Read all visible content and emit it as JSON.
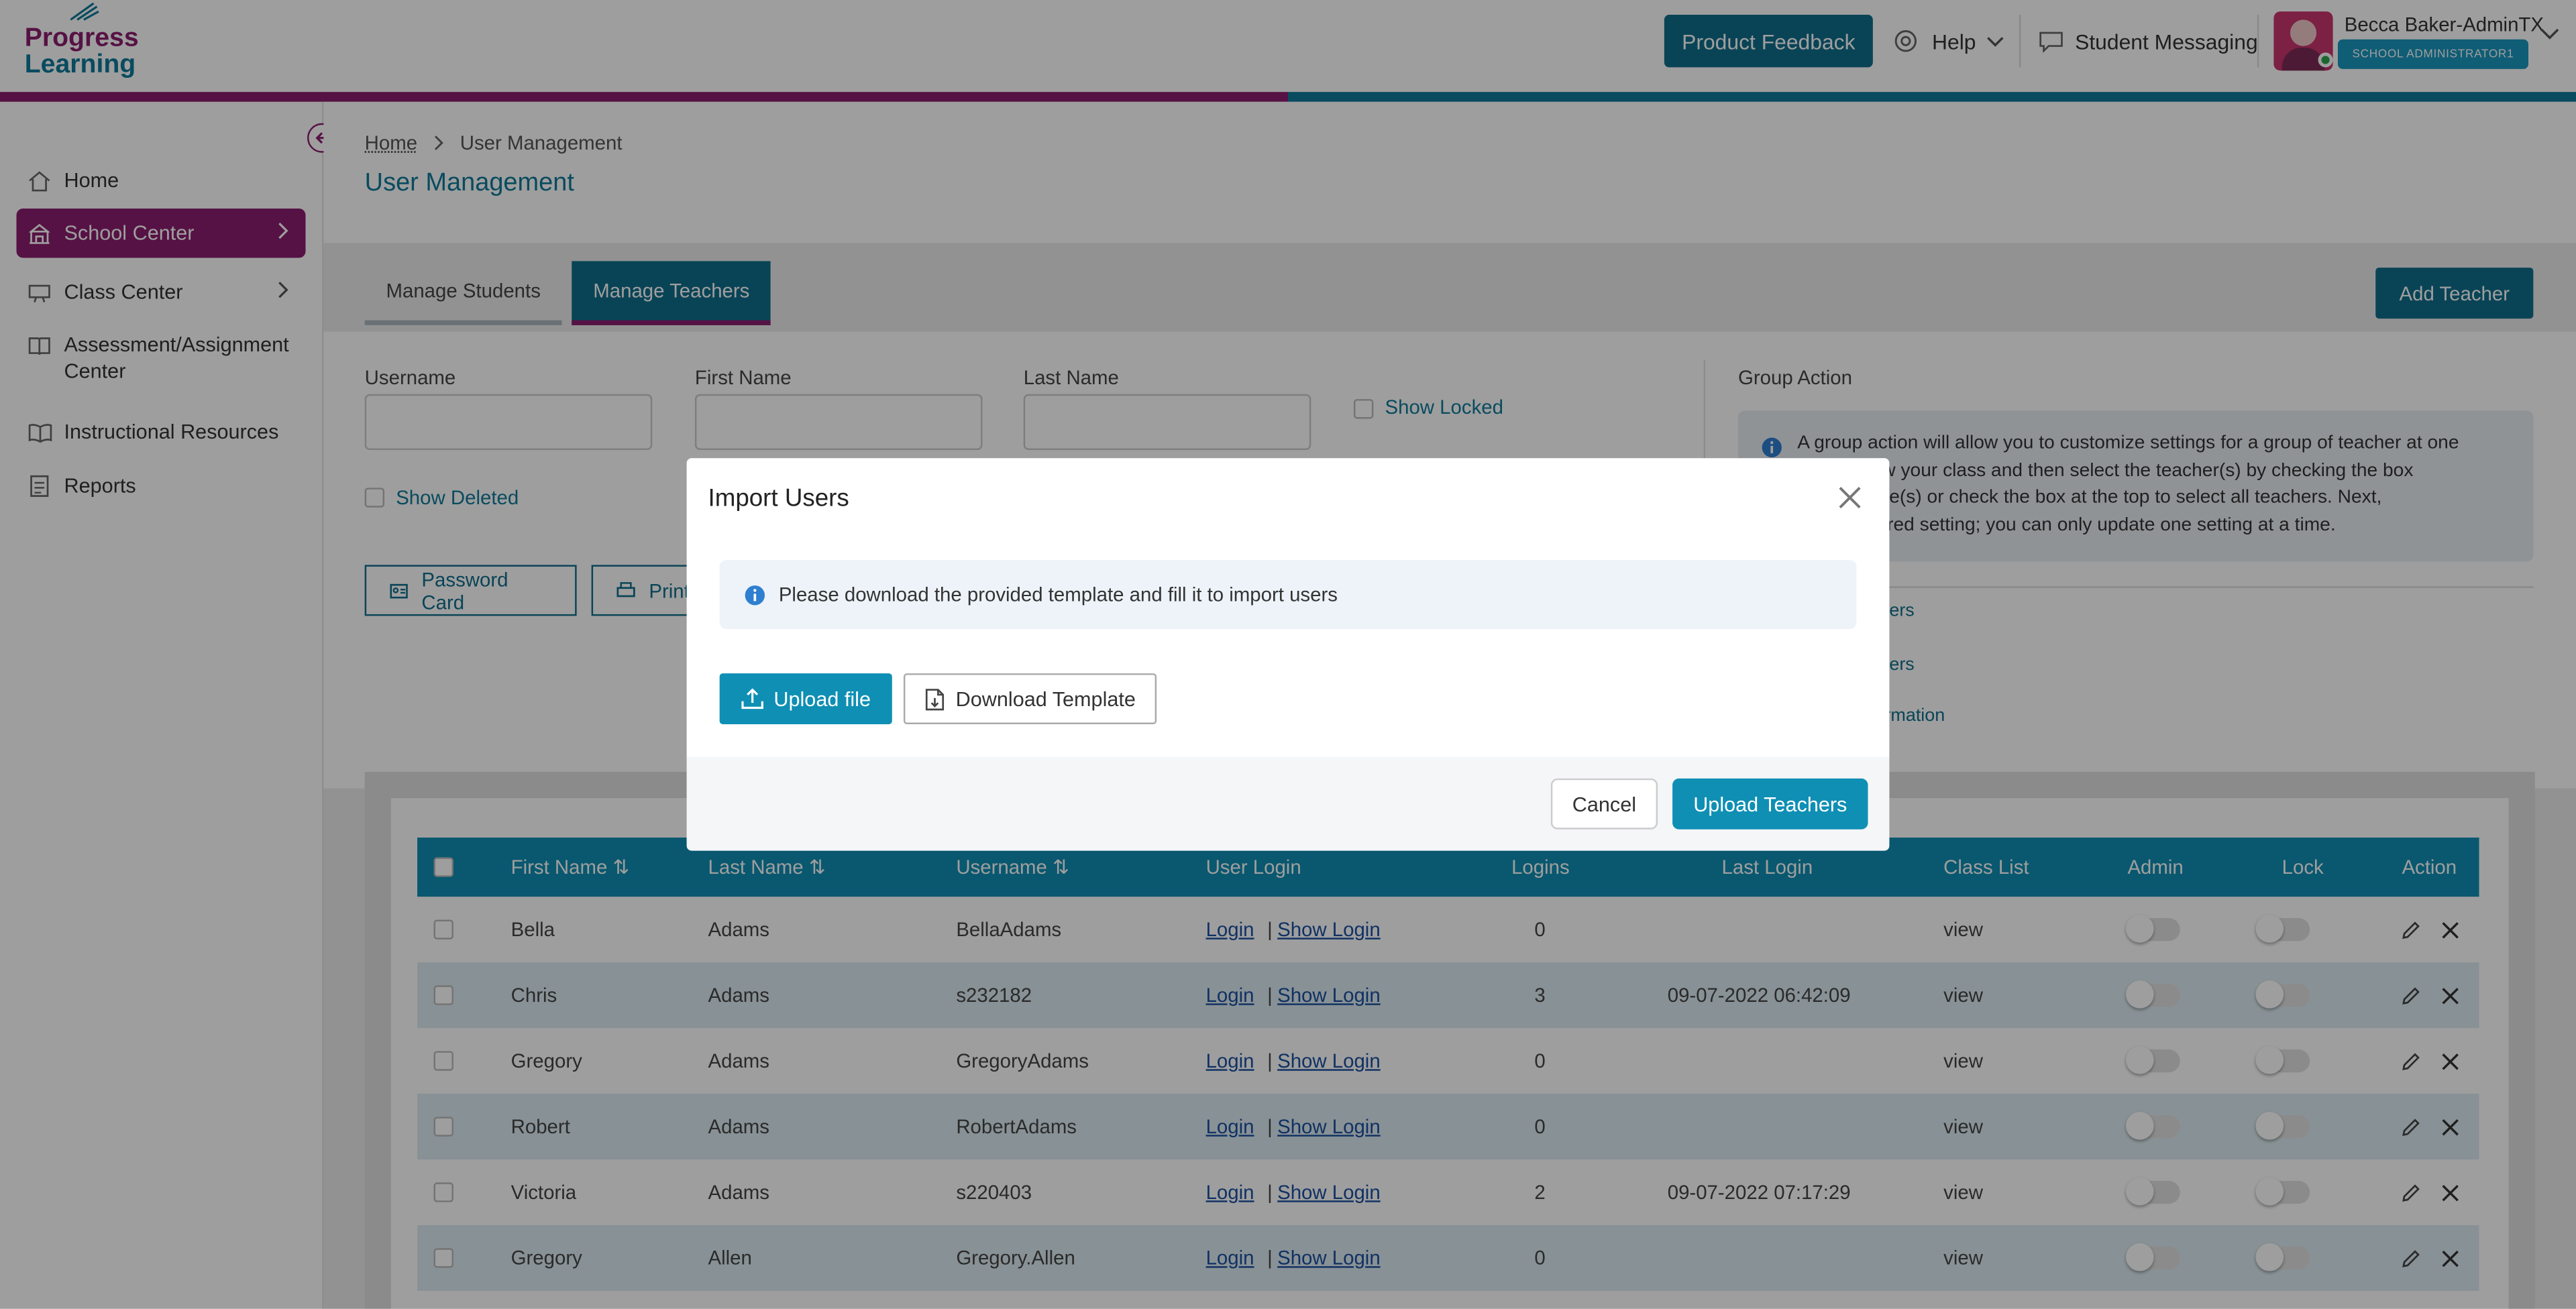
{
  "header": {
    "logo_line1": "Progress",
    "logo_line2": "Learning",
    "product_feedback": "Product Feedback",
    "help": "Help",
    "student_messaging": "Student Messaging",
    "user_name": "Becca Baker-AdminTX",
    "user_role": "SCHOOL ADMINISTRATOR1"
  },
  "colors": {
    "brand_purple": "#8c1d6e",
    "brand_teal": "#0f7a99",
    "button_teal": "#0f8fb4"
  },
  "sidebar": {
    "items": [
      {
        "label": "Home",
        "icon": "home-icon"
      },
      {
        "label": "School Center",
        "icon": "school-icon",
        "active": true
      },
      {
        "label": "Class Center",
        "icon": "class-icon"
      },
      {
        "label": "Assessment/Assignment",
        "label2": "Center",
        "icon": "book-icon"
      },
      {
        "label": "Instructional Resources",
        "icon": "book-open-icon"
      },
      {
        "label": "Reports",
        "icon": "report-icon"
      }
    ]
  },
  "breadcrumb": {
    "home": "Home",
    "current": "User Management"
  },
  "page_title": "User Management",
  "tabs": [
    {
      "label": "Manage Students"
    },
    {
      "label": "Manage Teachers",
      "active": true
    }
  ],
  "add_teacher": "Add Teacher",
  "filters": {
    "username_label": "Username",
    "first_name_label": "First Name",
    "last_name_label": "Last Name",
    "show_locked": "Show Locked",
    "show_deleted": "Show Deleted",
    "password_card": "Password Card",
    "print": "Print"
  },
  "group_action": {
    "title": "Group Action",
    "info_lines": [
      "A group action will allow you to customize settings for a group of teacher at one",
      "to view your class and then select the teacher(s) by checking the box",
      "ir name(s) or check the box at the top to select all teachers. Next,",
      "e desired setting; you can only update one setting at a time."
    ],
    "link1": "ers",
    "link2": "ers",
    "link3": "formation"
  },
  "table": {
    "columns": [
      "First Name",
      "Last Name",
      "Username",
      "User Login",
      "Logins",
      "Last Login",
      "Class List",
      "Admin",
      "Lock",
      "Action"
    ],
    "rows": [
      {
        "first": "Bella",
        "last": "Adams",
        "username": "BellaAdams",
        "login": "Login",
        "show_login": "Show Login",
        "logins": "0",
        "last_login": "",
        "class_list": "view"
      },
      {
        "first": "Chris",
        "last": "Adams",
        "username": "s232182",
        "login": "Login",
        "show_login": "Show Login",
        "logins": "3",
        "last_login": "09-07-2022 06:42:09",
        "class_list": "view"
      },
      {
        "first": "Gregory",
        "last": "Adams",
        "username": "GregoryAdams",
        "login": "Login",
        "show_login": "Show Login",
        "logins": "0",
        "last_login": "",
        "class_list": "view"
      },
      {
        "first": "Robert",
        "last": "Adams",
        "username": "RobertAdams",
        "login": "Login",
        "show_login": "Show Login",
        "logins": "0",
        "last_login": "",
        "class_list": "view"
      },
      {
        "first": "Victoria",
        "last": "Adams",
        "username": "s220403",
        "login": "Login",
        "show_login": "Show Login",
        "logins": "2",
        "last_login": "09-07-2022 07:17:29",
        "class_list": "view"
      },
      {
        "first": "Gregory",
        "last": "Allen",
        "username": "Gregory.Allen",
        "login": "Login",
        "show_login": "Show Login",
        "logins": "0",
        "last_login": "",
        "class_list": "view"
      }
    ]
  },
  "modal": {
    "title": "Import Users",
    "info": "Please download the provided template and fill it to import users",
    "upload_file": "Upload file",
    "download_template": "Download Template",
    "cancel": "Cancel",
    "upload_teachers": "Upload Teachers"
  }
}
